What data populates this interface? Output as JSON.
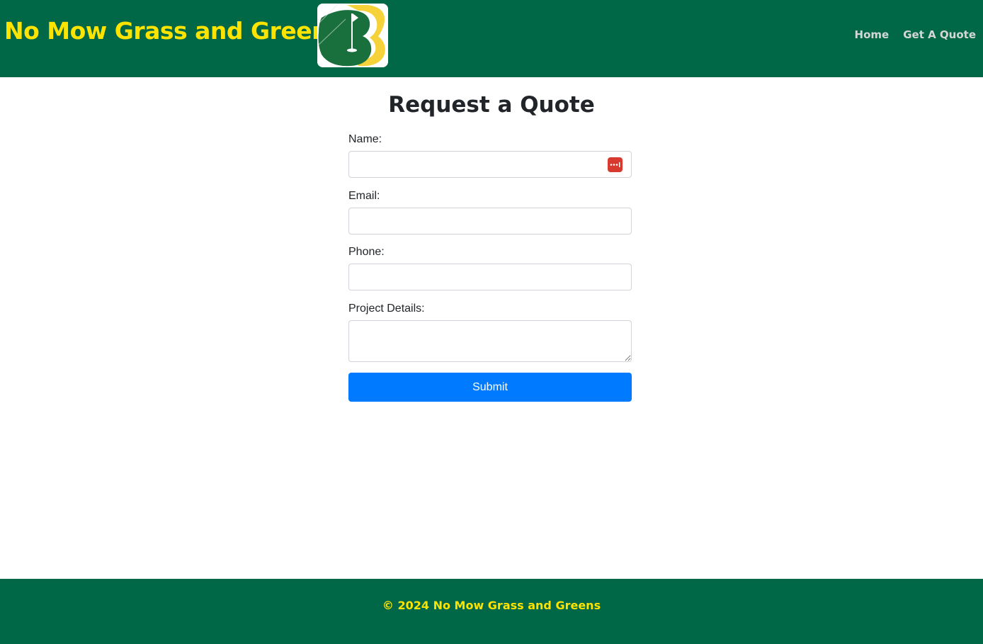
{
  "header": {
    "title": "No Mow Grass and Greens",
    "logo": "golf-green-flag-logo",
    "nav": [
      {
        "label": "Home"
      },
      {
        "label": "Get A Quote"
      }
    ]
  },
  "main": {
    "title": "Request a Quote",
    "fields": {
      "name": {
        "label": "Name:",
        "value": ""
      },
      "email": {
        "label": "Email:",
        "value": ""
      },
      "phone": {
        "label": "Phone:",
        "value": ""
      },
      "details": {
        "label": "Project Details:",
        "value": ""
      }
    },
    "submit_label": "Submit",
    "password_manager_icon": "password-manager-icon"
  },
  "footer": {
    "text": "© 2024 No Mow Grass and Greens"
  },
  "colors": {
    "brand_green": "#006747",
    "brand_yellow": "#fce300",
    "button_blue": "#007bff"
  }
}
